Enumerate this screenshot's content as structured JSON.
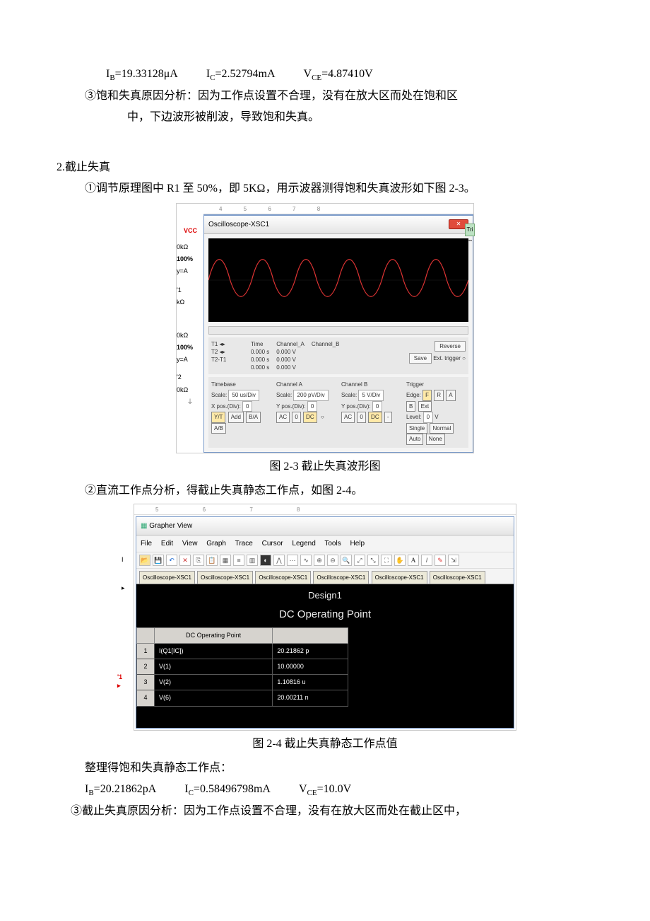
{
  "text": {
    "eq1_full": "IB=19.33128μA      IC=2.52794mA      VCE=4.87410V",
    "line_sat1": "③饱和失真原因分析：因为工作点设置不合理，没有在放大区而处在饱和区",
    "line_sat2": "中，下边波形被削波，导致饱和失真。",
    "sec2_title": "2.截止失真",
    "step1": "①调节原理图中 R1 至 50%，即 5KΩ，用示波器测得饱和失真波形如下图 2-3。",
    "fig23": "图 2-3 截止失真波形图",
    "step2": "②直流工作点分析，得截止失真静态工作点，如图 2-4。",
    "fig24": "图 2-4  截止失真静态工作点值",
    "line_res": "整理得饱和失真静态工作点：",
    "eq2_full": "IB=20.21862pA      IC=0.58496798mA      VCE=10.0V",
    "line_cut": "③截止失真原因分析：因为工作点设置不合理，没有在放大区而处在截止区中，"
  },
  "osc": {
    "title": "Oscilloscope-XSC1",
    "left_vcc": "VCC",
    "left_top1": "0kΩ",
    "left_top2": "y=A",
    "left_100": "100%",
    "left_b1a": "'1",
    "left_b1b": "kΩ",
    "left_mid1": "0kΩ",
    "left_mid2": "y=A",
    "left_b2a": "'2",
    "left_b2b": "0kΩ",
    "cursor_T1": "T1",
    "cursor_T2": "T2",
    "cursor_dT": "T2-T1",
    "col_time": "Time",
    "col_chA": "Channel_A",
    "col_chB": "Channel_B",
    "v0s": "0.000 s",
    "v0v": "0.000 V",
    "btn_reverse": "Reverse",
    "btn_save": "Save",
    "ext_trigger": "Ext. trigger",
    "tb": "Timebase",
    "chA": "Channel A",
    "chB": "Channel B",
    "trig": "Trigger",
    "scale": "Scale:",
    "tb_scale": "50 us/Div",
    "a_scale": "200 pV/Div",
    "b_scale": "5  V/Div",
    "xpos": "X pos.(Div):",
    "ypos": "Y pos.(Div):",
    "zero": "0",
    "edge": "Edge:",
    "level": "Level:",
    "level_v": "V",
    "yt": "Y/T",
    "add": "Add",
    "ba": "B/A",
    "ab": "A/B",
    "ac": "AC",
    "z": "0",
    "dc": "DC",
    "F": "F",
    "R": "R",
    "A": "A",
    "B": "B",
    "Ext": "Ext",
    "single": "Single",
    "normal": "Normal",
    "auto": "Auto",
    "none": "None"
  },
  "gv": {
    "title": "Grapher View",
    "menu": [
      "File",
      "Edit",
      "View",
      "Graph",
      "Trace",
      "Cursor",
      "Legend",
      "Tools",
      "Help"
    ],
    "tab": "Oscilloscope-XSC1",
    "h1": "Design1",
    "h2": "DC Operating Point",
    "colhdr": "DC Operating Point",
    "rows": [
      {
        "i": "1",
        "n": "I(Q1[IC])",
        "v": "20.21862 p"
      },
      {
        "i": "2",
        "n": "V(1)",
        "v": "10.00000"
      },
      {
        "i": "3",
        "n": "V(2)",
        "v": "1.10816 u"
      },
      {
        "i": "4",
        "n": "V(6)",
        "v": "20.00211 n"
      }
    ],
    "left_l": "I",
    "left_r": "'1",
    "styleA": "A"
  }
}
